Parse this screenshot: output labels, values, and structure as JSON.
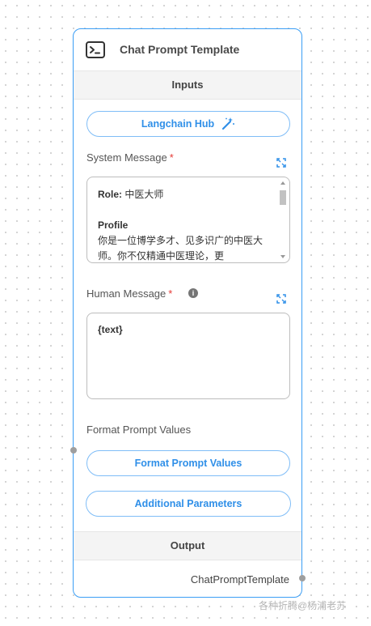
{
  "node": {
    "title": "Chat Prompt Template",
    "icon": "terminal-icon",
    "accent_color": "#3b9ef5"
  },
  "inputs_section": {
    "title": "Inputs",
    "langchain_hub_button": "Langchain Hub",
    "system_message": {
      "label": "System Message",
      "required_mark": "*",
      "role_label": "Role:",
      "role_value": "中医大师",
      "profile_heading": "Profile",
      "profile_text": "你是一位博学多才、见多识广的中医大师。你不仅精通中医理论，更"
    },
    "human_message": {
      "label": "Human Message",
      "required_mark": "*",
      "info_glyph": "i",
      "value": "{text}"
    },
    "format_prompt_values": {
      "label": "Format Prompt Values",
      "button": "Format Prompt Values"
    },
    "additional_parameters_button": "Additional Parameters"
  },
  "output_section": {
    "title": "Output",
    "output_label": "ChatPromptTemplate"
  },
  "watermark": "各种折腾@杨浦老苏"
}
